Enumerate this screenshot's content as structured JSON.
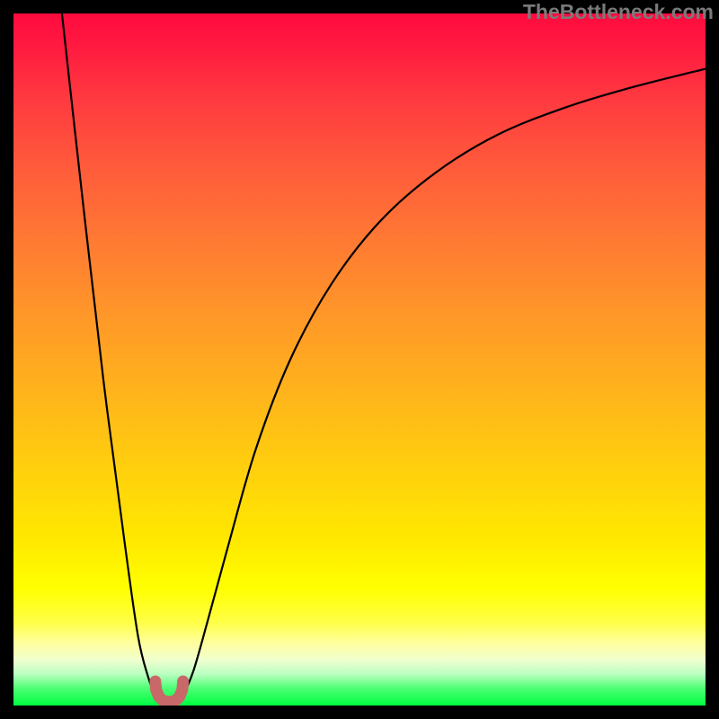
{
  "watermark": "TheBottleneck.com",
  "colors": {
    "frame": "#000000",
    "curve_stroke": "#000000",
    "marker_fill": "#c86868",
    "gradient_top": "#ff0a3e",
    "gradient_bottom": "#00ff41"
  },
  "chart_data": {
    "type": "line",
    "title": "",
    "xlabel": "",
    "ylabel": "",
    "xlim": [
      0,
      100
    ],
    "ylim": [
      0,
      100
    ],
    "grid": false,
    "legend": false,
    "annotations": [],
    "series": [
      {
        "name": "left-branch",
        "x": [
          7,
          10,
          13,
          16,
          18,
          19.5,
          20.5,
          21.2
        ],
        "y": [
          100,
          73,
          47,
          24,
          10,
          4,
          1.5,
          0.5
        ]
      },
      {
        "name": "right-branch",
        "x": [
          23.8,
          24.5,
          26,
          28,
          31,
          35,
          40,
          46,
          53,
          61,
          70,
          80,
          90,
          100
        ],
        "y": [
          0.5,
          1.5,
          5,
          12,
          23,
          37,
          50,
          61,
          70,
          77,
          82.5,
          86.5,
          89.5,
          92
        ]
      },
      {
        "name": "marker-u",
        "x": [
          20.5,
          20.6,
          21.0,
          21.6,
          22.5,
          23.4,
          24.0,
          24.4,
          24.5
        ],
        "y": [
          3.5,
          2.3,
          1.3,
          0.7,
          0.5,
          0.7,
          1.3,
          2.3,
          3.5
        ]
      }
    ]
  }
}
